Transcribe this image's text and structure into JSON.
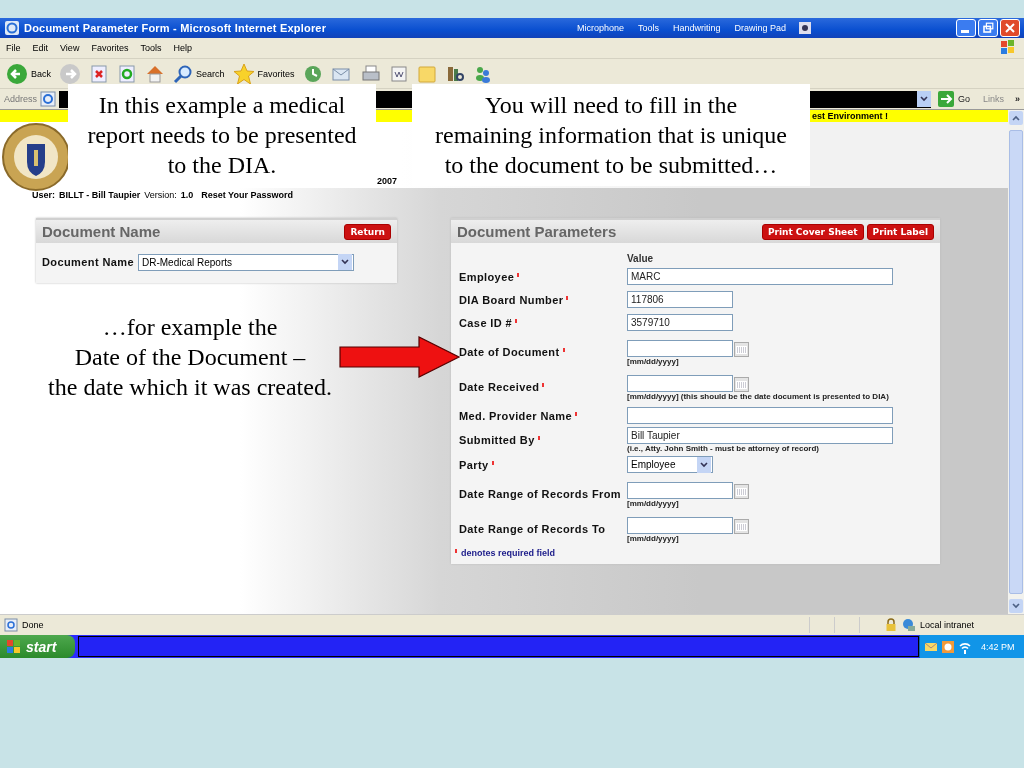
{
  "window": {
    "title": "Document Parameter Form - Microsoft Internet Explorer",
    "language_bar": [
      "Microphone",
      "Tools",
      "Handwriting",
      "Drawing Pad"
    ]
  },
  "menu": [
    "File",
    "Edit",
    "View",
    "Favorites",
    "Tools",
    "Help"
  ],
  "toolbar": {
    "back": "Back",
    "search": "Search",
    "favorites": "Favorites"
  },
  "address_bar": {
    "label": "Address",
    "go": "Go",
    "links": "Links",
    "chevron": "»"
  },
  "banner": {
    "notice": "est Environment !",
    "date": "2007"
  },
  "user_line": {
    "user_label": "User:",
    "user": "BILLT - Bill Taupier",
    "version_label": "Version:",
    "version": "1.0",
    "reset_link": "Reset Your Password"
  },
  "document_name_panel": {
    "title": "Document Name",
    "return_button": "Return",
    "field_label": "Document Name",
    "field_value": "DR-Medical Reports"
  },
  "parameters_panel": {
    "title": "Document Parameters",
    "buttons": [
      "Print Cover Sheet",
      "Print Label"
    ],
    "column_heading": "Value",
    "fields": [
      {
        "label": "Employee",
        "required": true,
        "kind": "wide",
        "value": "MARC"
      },
      {
        "label": "DIA Board Number",
        "required": true,
        "kind": "short",
        "value": "117806"
      },
      {
        "label": "Case ID #",
        "required": true,
        "kind": "short",
        "value": "3579710"
      },
      {
        "label": "Date of Document",
        "required": true,
        "kind": "date",
        "hint": "[mm/dd/yyyy]"
      },
      {
        "label": "Date Received",
        "required": true,
        "kind": "date",
        "hint": "[mm/dd/yyyy] (this should be the date document is presented to DIA)"
      },
      {
        "label": "Med. Provider Name",
        "required": true,
        "kind": "wide"
      },
      {
        "label": "Submitted By",
        "required": true,
        "kind": "wide",
        "value": "Bill Taupier",
        "hint": "(i.e., Atty. John Smith - must be attorney of record)"
      },
      {
        "label": "Party",
        "required": true,
        "kind": "select",
        "value": "Employee"
      },
      {
        "label": "Date Range of Records From",
        "required": false,
        "kind": "date",
        "hint": "[mm/dd/yyyy]"
      },
      {
        "label": "Date Range of Records To",
        "required": false,
        "kind": "date",
        "hint": "[mm/dd/yyyy]"
      }
    ],
    "footnote": "denotes required field"
  },
  "status_bar": {
    "text": "Done",
    "zone": "Local intranet"
  },
  "taskbar": {
    "start": "start",
    "clock": "4:42 PM"
  },
  "callouts": [
    {
      "lines": [
        "In this example a medical",
        "report needs to be presented",
        "to the DIA."
      ]
    },
    {
      "lines": [
        "You will need to fill in the",
        "remaining information that is unique",
        "to the document to be submitted…"
      ]
    }
  ],
  "side_note": {
    "lines": [
      "…for example the",
      "Date of the Document –",
      "the date which it was created."
    ]
  }
}
